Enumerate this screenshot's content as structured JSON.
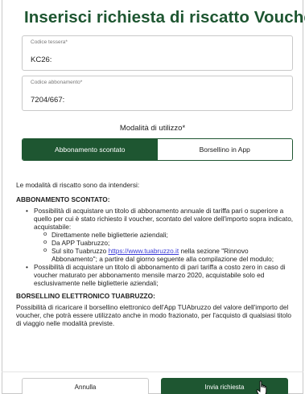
{
  "header": {
    "title": "Inserisci richiesta di riscatto Voucher"
  },
  "form": {
    "card_number": {
      "label": "Codice tessera*",
      "value": "KC26:"
    },
    "subscription_code": {
      "label": "Codice abbonamento*",
      "value": "7204/667:"
    },
    "mode": {
      "label": "Modalità di utilizzo*",
      "options": [
        "Abbonamento scontato",
        "Borsellino in App"
      ],
      "selected": "Abbonamento scontato"
    }
  },
  "info": {
    "intro": "Le modalità di riscatto sono da intendersi:",
    "section1": {
      "heading": "ABBONAMENTO SCONTATO",
      "bullet1": "Possibilità di acquistare un titolo di abbonamento annuale di tariffa pari o superiore a quello per cui è stato richiesto il voucher, scontato del valore dell'importo sopra indicato, acquistabile:",
      "sub1": "Direttamente nelle biglietterie aziendali;",
      "sub2": "Da APP Tuabruzzo;",
      "sub3_pre": "Sul sito Tuabruzzo ",
      "sub3_link": "https://www.tuabruzzo.it",
      "sub3_post": " nella sezione \"Rinnovo Abbonamento\"; a partire dal giorno seguente alla compilazione del modulo;",
      "bullet2": "Possibilità di acquistare un titolo di abbonamento di pari tariffa a costo zero in caso di voucher maturato per abbonamento mensile marzo 2020, acquistabile solo ed esclusivamente nelle biglietterie aziendali;"
    },
    "section2": {
      "heading": "BORSELLINO ELETTRONICO TUABRUZZO",
      "text": "Possibilità di ricaricare il borsellino elettronico dell'App TUAbruzzo del valore dell'importo del voucher, che potrà essere utilizzato anche in modo frazionato, per l'acquisto di qualsiasi titolo di viaggio nelle modalità previste."
    }
  },
  "footer": {
    "cancel_label": "Annulla",
    "submit_label": "Invia richiesta"
  },
  "colors": {
    "brand_green": "#1e5631",
    "link": "#3b3bd6"
  }
}
